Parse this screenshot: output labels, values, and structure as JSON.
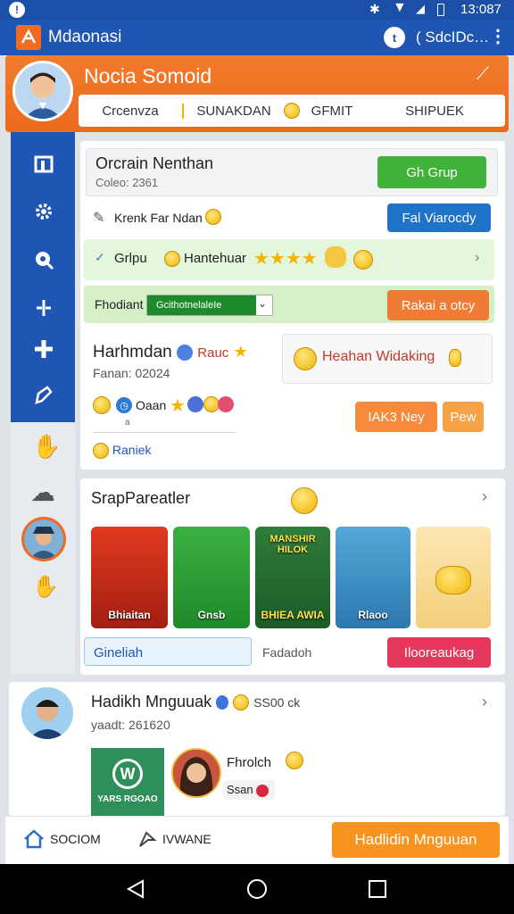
{
  "status": {
    "time": "13:087"
  },
  "appbar": {
    "title": "Mdaonasi",
    "right_label": "( ЅdcIDc…"
  },
  "profile": {
    "name": "Nocia Somoid",
    "tabs": [
      "Crcenvza",
      "SUNAKDAN",
      "GFMIT",
      "SHIPUEK"
    ]
  },
  "card1": {
    "title": "Orcrain Nenthan",
    "subtitle": "Coleo: 2361",
    "button": "Gh Grup"
  },
  "row2": {
    "label": "Krenk Far Ndan",
    "button": "Fal Viarocdy"
  },
  "row3": {
    "label1": "Grlpu",
    "label2": "Hantehuar"
  },
  "row4": {
    "label": "Fhodiant",
    "select_value": "GcithotnelaleIe",
    "button": "Rakai a otcy"
  },
  "card2": {
    "name": "Harhmdan",
    "badge": "Rauc",
    "date": "Fanan: 02024",
    "chip": "Oaan",
    "caption": "a",
    "link": "Raniek",
    "callout": "Heahan Widaking",
    "btn1": "IAK3 Ney",
    "btn2": "Pew"
  },
  "section": {
    "title": "SrapPareatler",
    "tiles": [
      "Bhiaitan",
      "Gnsb",
      "BHIEA AWIA",
      "Rlaoo",
      ""
    ],
    "tile_top_label": "MANSHIR HILOK",
    "input_value": "Gineliah",
    "middle_text": "Fadadoh",
    "button": "Ilooreaukag"
  },
  "post": {
    "name": "Hadikh Mnguuak",
    "badge": "SS00 ck",
    "date": "yaadt: 261620",
    "thumb_label": "YARS RGOAO",
    "person_name": "Fhrolch",
    "person_tag": "Ssan"
  },
  "bottombar": {
    "home": "SOCIOM",
    "share": "IVWANE",
    "cta": "Hadlidin Mnguuan"
  }
}
